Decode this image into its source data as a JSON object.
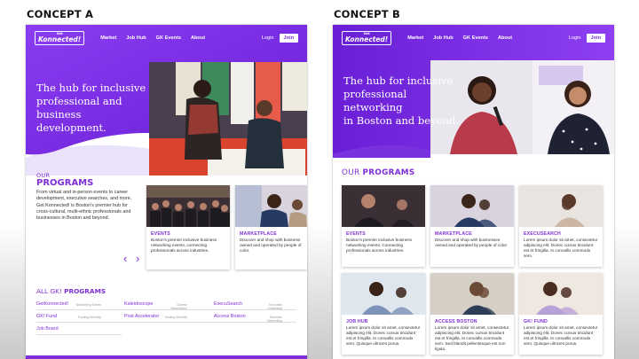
{
  "concepts": [
    {
      "label": "CONCEPT A",
      "nav": {
        "logo_top": "Get",
        "logo_main": "Konnected!",
        "links": [
          "Market",
          "Job Hub",
          "GK Events",
          "About"
        ],
        "login": "Login",
        "join": "Join"
      },
      "hero_lines": [
        "The hub for inclusive",
        "professional and business",
        "development."
      ],
      "programs": {
        "small": "OUR",
        "big": "PROGRAMS",
        "intro": "From virtual and in-person events to career development, executive searches, and more, Get Konnected! is Boston's premier hub for cross-cultural, multi-ethnic professionals and businesses in Boston and beyond."
      },
      "cards": [
        {
          "title": "EVENTS",
          "desc": "Boston's premier inclusive business networking events, connecting professionals across industries."
        },
        {
          "title": "MARKETPLACE",
          "desc": "Discover and shop with business owned and operated by people of color."
        }
      ],
      "carousel": {
        "prev": "‹",
        "next": "›"
      },
      "all_programs": {
        "prefix": "ALL GK!",
        "suffix": "PROGRAMS",
        "rows": [
          [
            {
              "name": "GetKonnected!",
              "tag": "Networking Events"
            },
            {
              "name": "Kaleidoscope",
              "tag": "Diverse Marketplace"
            },
            {
              "name": "ExecuSearch",
              "tag": "Executive Leadership"
            }
          ],
          [
            {
              "name": "GK! Fund",
              "tag": "Funding Diversity"
            },
            {
              "name": "Post Accelerator",
              "tag": "Scaling Diversity"
            },
            {
              "name": "Access Boston",
              "tag": "Business Networking"
            }
          ],
          [
            {
              "name": "Job Board",
              "tag": ""
            }
          ]
        ]
      }
    },
    {
      "label": "CONCEPT B",
      "nav": {
        "logo_top": "Get",
        "logo_main": "Konnected!",
        "links": [
          "Market",
          "Job Hub",
          "GK Events",
          "About"
        ],
        "login": "Login",
        "join": "Join"
      },
      "hero_lines": [
        "The hub for inclusive",
        "professional networking",
        "in Boston and beyond."
      ],
      "programs": {
        "small": "OUR",
        "big": "PROGRAMS"
      },
      "cards": [
        {
          "title": "EVENTS",
          "desc": "Boston's premier inclusive business networking events. Connecting professionals across industries."
        },
        {
          "title": "MARKETPLACE",
          "desc": "Discover and shop with businesses owned and operated by people of color."
        },
        {
          "title": "EXECUSEARCH",
          "desc": "Lorem ipsum dolor sit amet, consectetur adipiscing elit. Donec cursus tincidunt est et fringilla. In convallis commodo sem."
        },
        {
          "title": "JOB HUB",
          "desc": "Lorem ipsum dolor sit amet, consectetur adipiscing elit. Donec cursus tincidunt est et fringilla. In convallis commodo sem. Quisque ultricies purus."
        },
        {
          "title": "ACCESS BOSTON",
          "desc": "Lorem ipsum dolor sit amet, consectetur adipiscing elit. Donec cursus tincidunt est et fringilla. In convallis commodo sem. Sed blandit pellentesque est non ligula."
        },
        {
          "title": "GK! FUND",
          "desc": "Lorem ipsum dolor sit amet, consectetur adipiscing elit. Donec cursus tincidunt est et fringilla. In convallis commodo sem. Quisque ultricies purus."
        }
      ]
    }
  ],
  "colors": {
    "brand_purple": "#7e2fd8",
    "purple_dark": "#5b14c4",
    "purple_light": "#a05cf0"
  }
}
